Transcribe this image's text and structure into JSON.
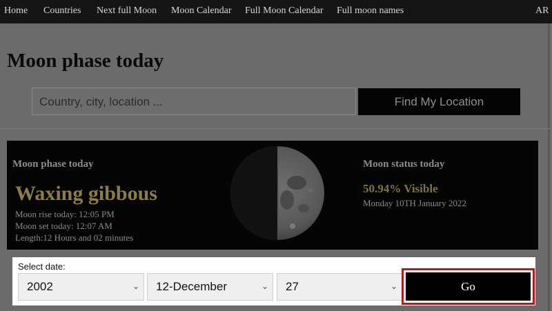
{
  "nav": {
    "items": [
      "Home",
      "Countries",
      "Next full Moon",
      "Moon Calendar",
      "Full Moon Calendar",
      "Full moon names"
    ],
    "lang": "AR"
  },
  "page": {
    "title": "Moon phase today"
  },
  "search": {
    "placeholder": "Country, city, location ...",
    "button_label": "Find My Location"
  },
  "moon_panel": {
    "left_heading": "Moon phase today",
    "phase_name": "Waxing gibbous",
    "rise": "Moon rise today: 12:05 PM",
    "set": "Moon set today: 12:07 AM",
    "length": "Length:12 Hours and 02 minutes",
    "right_heading": "Moon status today",
    "visible": "50.94% Visible",
    "date": "Monday 10TH January 2022",
    "illumination_fraction": 0.5094
  },
  "date_selector": {
    "label": "Select date:",
    "year": "2002",
    "month": "12-December",
    "day": "27",
    "go_label": "Go"
  },
  "colors": {
    "highlight": "#c0141a",
    "phase_text": "#8c7c45"
  }
}
